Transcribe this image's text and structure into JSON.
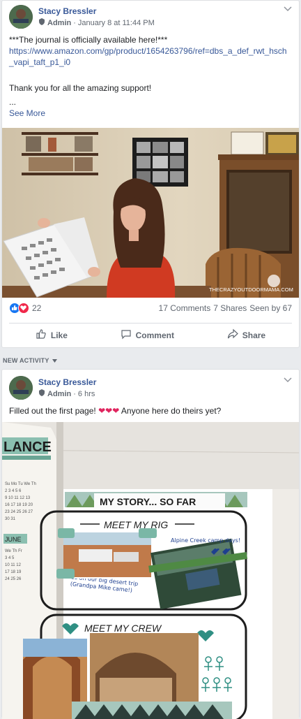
{
  "post1": {
    "author": "Stacy Bressler",
    "role": "Admin",
    "timestamp": "January 8 at 11:44 PM",
    "line1": "***The journal is officially available here!***",
    "link": "https://www.amazon.com/gp/product/1654263796/ref=dbs_a_def_rwt_hsch_vapi_taft_p1_i0",
    "line2": "Thank you for all the amazing support!",
    "ellipsis": "...",
    "see_more": "See More",
    "watermark": "THECRAZYOUTDOORMAMA.COM",
    "reaction_count": "22",
    "comments": "17 Comments",
    "shares": "7 Shares",
    "seen_by": "Seen by 67",
    "like": "Like",
    "comment": "Comment",
    "share": "Share"
  },
  "section_label": "NEW ACTIVITY",
  "post2": {
    "author": "Stacy Bressler",
    "role": "Admin",
    "timestamp": "6 hrs",
    "text_before": "Filled out the first page!",
    "hearts": "❤❤❤",
    "text_after": "Anyone here do theirs yet?",
    "journal": {
      "lance": "LANCE",
      "my_story": "MY STORY... SO FAR",
      "meet_my_rig": "MEET MY RIG",
      "alpine": "Alpine Creek camp days!",
      "desert_note": "us on our big desert trip (Grandpa Mike came!)",
      "meet_my_crew": "MEET MY CREW",
      "june": "JUNE"
    }
  },
  "colors": {
    "link": "#385898",
    "like_blue": "#1877f2",
    "love_red": "#f0284a"
  }
}
